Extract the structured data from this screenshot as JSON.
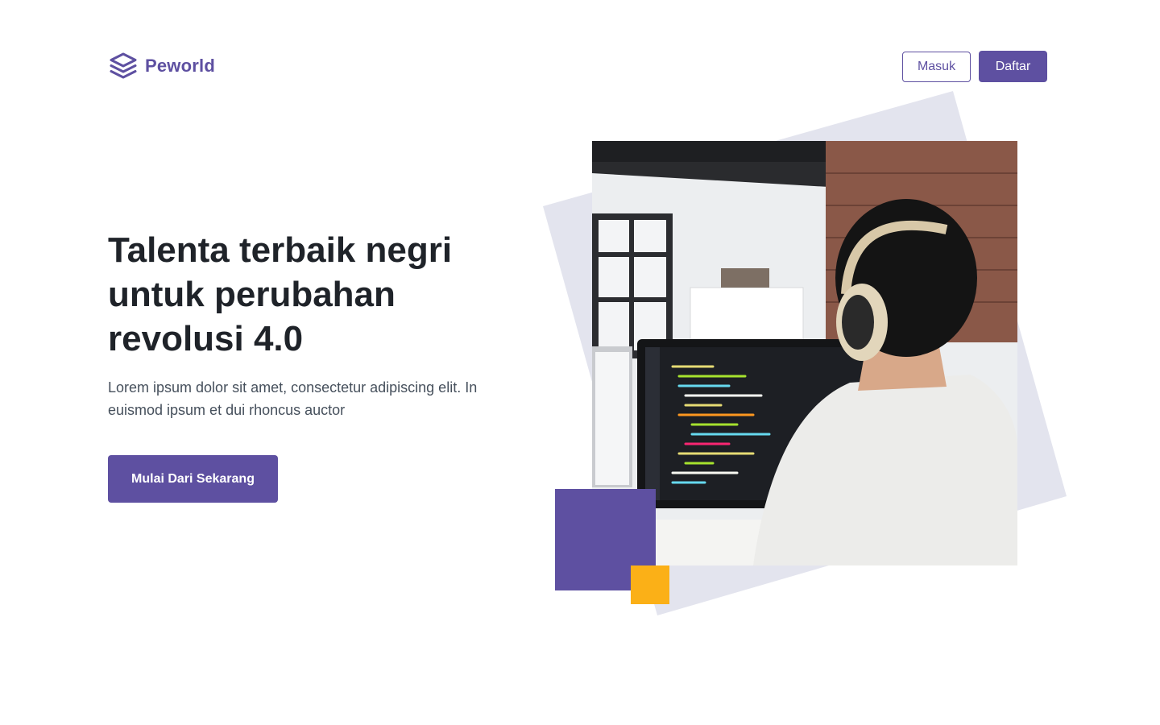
{
  "brand": {
    "name": "Peworld",
    "icon": "layers-icon",
    "color": "#5e50a1"
  },
  "nav": {
    "login_label": "Masuk",
    "register_label": "Daftar"
  },
  "hero": {
    "title": "Talenta terbaik negri untuk perubahan revolusi 4.0",
    "description": "Lorem ipsum dolor sit amet, consectetur adipiscing elit. In euismod ipsum et dui rhoncus auctor",
    "cta_label": "Mulai Dari Sekarang",
    "image": "developer-with-headphones-photo"
  },
  "colors": {
    "primary": "#5e50a1",
    "accent": "#fbb017",
    "backdrop": "#e3e4ee",
    "heading": "#1f2329",
    "body": "#46505c"
  }
}
